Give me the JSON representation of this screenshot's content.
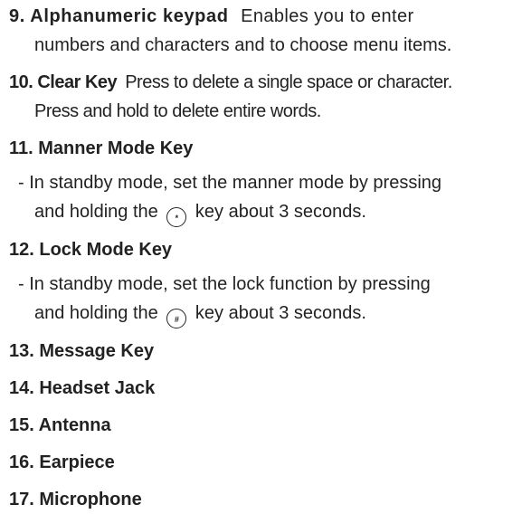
{
  "items": [
    {
      "title": "9. Alphanumeric keypad",
      "line1": "Enables you to enter",
      "line2": "numbers and characters and to choose menu items."
    },
    {
      "title": "10. Clear Key",
      "line1": "Press to delete a single space or character.",
      "line2": "Press and hold to  delete entire words."
    },
    {
      "title": "11. Manner Mode Key",
      "line1": "- In standby mode, set the manner mode by pressing",
      "line2a": "and holding the",
      "icon": "*",
      "line2b": "key about 3 seconds."
    },
    {
      "title": "12. Lock Mode Key",
      "line1": "- In standby mode, set the lock function by pressing",
      "line2a": "and holding the",
      "icon": "#",
      "line2b": "key about 3 seconds."
    },
    {
      "title": "13. Message Key"
    },
    {
      "title": "14. Headset Jack"
    },
    {
      "title": "15. Antenna"
    },
    {
      "title": "16. Earpiece"
    },
    {
      "title": "17. Microphone"
    }
  ]
}
